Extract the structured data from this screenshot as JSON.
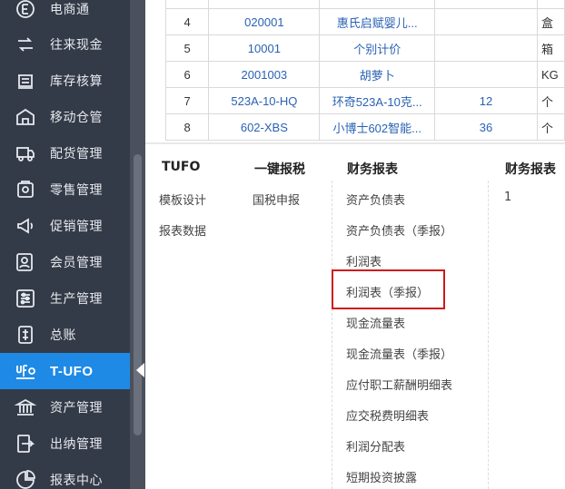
{
  "sidebar": {
    "items": [
      {
        "label": "电商通",
        "icon": "ecommerce-icon"
      },
      {
        "label": "往来现金",
        "icon": "transfer-icon"
      },
      {
        "label": "库存核算",
        "icon": "inventory-icon"
      },
      {
        "label": "移动仓管",
        "icon": "mobile-warehouse-icon"
      },
      {
        "label": "配货管理",
        "icon": "distribution-icon"
      },
      {
        "label": "零售管理",
        "icon": "retail-icon"
      },
      {
        "label": "促销管理",
        "icon": "promotion-icon"
      },
      {
        "label": "会员管理",
        "icon": "member-icon"
      },
      {
        "label": "生产管理",
        "icon": "production-icon"
      },
      {
        "label": "总账",
        "icon": "ledger-icon"
      },
      {
        "label": "T-UFO",
        "icon": "ufo-icon"
      },
      {
        "label": "资产管理",
        "icon": "asset-icon"
      },
      {
        "label": "出纳管理",
        "icon": "cashier-icon"
      },
      {
        "label": "报表中心",
        "icon": "report-center-icon"
      }
    ],
    "active_index": 10,
    "active_color": "#1e8ae6",
    "background": "#343b48"
  },
  "table": {
    "rows": [
      {
        "num": "",
        "code": "",
        "name": "",
        "qty": "",
        "unit": ""
      },
      {
        "num": "4",
        "code": "020001",
        "name": "惠氏启赋婴儿...",
        "qty": "",
        "unit": "盒"
      },
      {
        "num": "5",
        "code": "10001",
        "name": "个别计价",
        "qty": "",
        "unit": "箱"
      },
      {
        "num": "6",
        "code": "2001003",
        "name": "胡萝卜",
        "qty": "",
        "unit": "KG"
      },
      {
        "num": "7",
        "code": "523A-10-HQ",
        "name": "环奇523A-10克...",
        "qty": "12",
        "unit": "个"
      },
      {
        "num": "8",
        "code": "602-XBS",
        "name": "小博士602智能...",
        "qty": "36",
        "unit": "个"
      }
    ]
  },
  "menu": {
    "columns": [
      {
        "title": "TUFO",
        "items": [
          "模板设计",
          "报表数据"
        ]
      },
      {
        "title": "一键报税",
        "items": [
          "国税申报"
        ]
      },
      {
        "title": "财务报表",
        "items": [
          "资产负债表",
          "资产负债表（季报）",
          "利润表",
          "利润表（季报）",
          "现金流量表",
          "现金流量表（季报）",
          "应付职工薪酬明细表",
          "应交税费明细表",
          "利润分配表",
          "短期投资披露"
        ]
      },
      {
        "title": "财务报表",
        "items": [
          "1"
        ]
      }
    ],
    "highlighted_item": "利润表（季报）",
    "highlight_color": "#d0191a"
  }
}
